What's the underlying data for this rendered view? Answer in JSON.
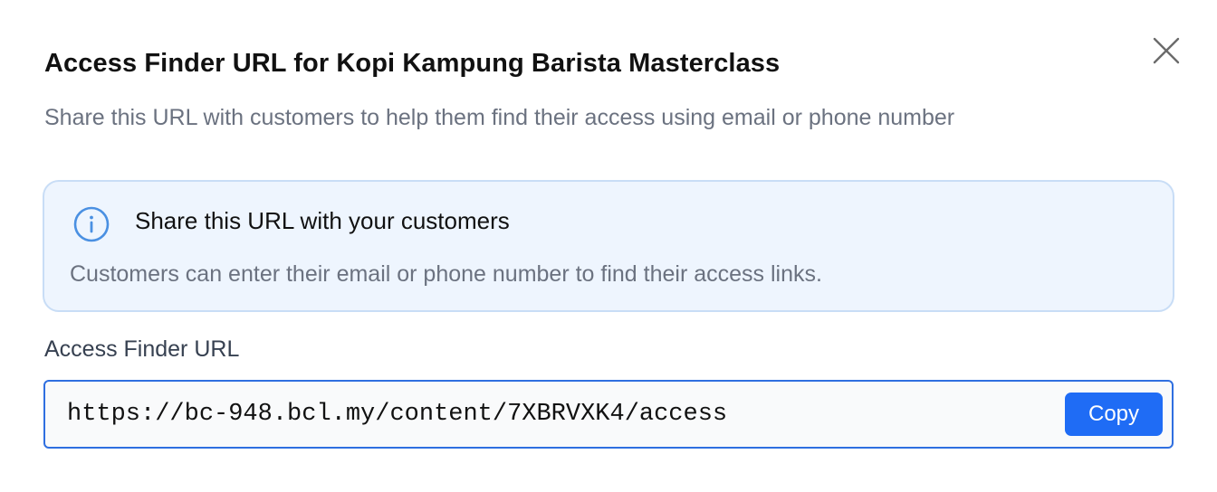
{
  "dialog": {
    "title": "Access Finder URL for Kopi Kampung Barista Masterclass",
    "subtitle": "Share this URL with customers to help them find their access using email or phone number",
    "close_icon": "close-icon"
  },
  "info_box": {
    "icon": "info-icon",
    "heading": "Share this URL with your customers",
    "text": "Customers can enter their email or phone number to find their access links."
  },
  "url_field": {
    "label": "Access Finder URL",
    "value": "https://bc-948.bcl.my/content/7XBRVXK4/access",
    "copy_label": "Copy"
  },
  "colors": {
    "accent": "#1f6cf5",
    "info_background": "#eef5fe",
    "info_border": "#c8ddf6",
    "info_icon": "#4a90e2",
    "muted_text": "#6b7280"
  }
}
